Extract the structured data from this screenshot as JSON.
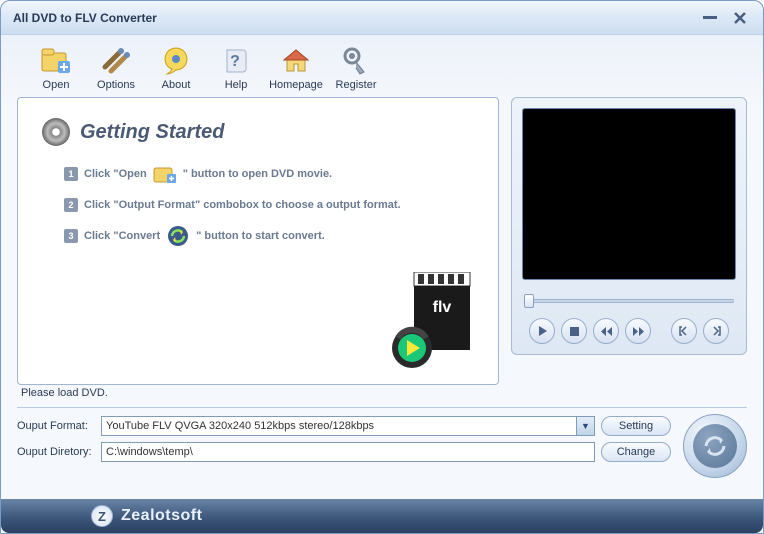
{
  "title": "All DVD to FLV Converter",
  "toolbar": [
    {
      "label": "Open",
      "icon": "open-icon"
    },
    {
      "label": "Options",
      "icon": "options-icon"
    },
    {
      "label": "About",
      "icon": "about-icon"
    },
    {
      "label": "Help",
      "icon": "help-icon"
    },
    {
      "label": "Homepage",
      "icon": "homepage-icon"
    },
    {
      "label": "Register",
      "icon": "register-icon"
    }
  ],
  "getting_started": {
    "title": "Getting Started",
    "step1_a": "Click \"Open",
    "step1_b": "\" button to open DVD movie.",
    "step2": "Click \"Output Format\" combobox  to choose a output format.",
    "step3_a": "Click \"Convert",
    "step3_b": "\" button to start convert."
  },
  "status": "Please load DVD.",
  "form": {
    "format_label": "Ouput Format:",
    "format_value": "YouTube FLV QVGA 320x240 512kbps stereo/128kbps",
    "directory_label": "Ouput Diretory:",
    "directory_value": "C:\\windows\\temp\\",
    "setting_btn": "Setting",
    "change_btn": "Change"
  },
  "footer": {
    "brand": "Zealotsoft",
    "logo_letter": "Z"
  }
}
